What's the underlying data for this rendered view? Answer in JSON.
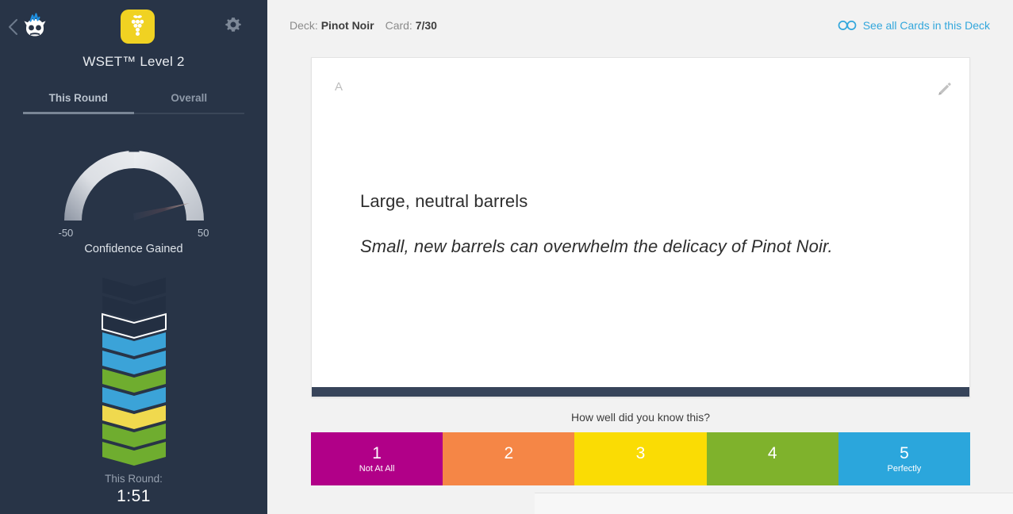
{
  "sidebar": {
    "back_icon": "back-chevron-icon",
    "brand_icon": "brainscape-owl-logo",
    "deck_icon": "grape-cluster-icon",
    "settings_icon": "gear-icon",
    "deck_title": "WSET™ Level 2",
    "tabs": [
      {
        "label": "This Round",
        "active": true
      },
      {
        "label": "Overall",
        "active": false
      }
    ],
    "gauge": {
      "min_label": "-50",
      "max_label": "50",
      "caption": "Confidence Gained",
      "min_value": -50,
      "max_value": 50,
      "needle_value": 50,
      "arc_color_start": "#8c94a2",
      "arc_color_end": "#e7e9ec"
    },
    "chevrons": {
      "colors": [
        "#232f42",
        "#232f42",
        "#232f42",
        "#3ba3d8",
        "#3ba3d8",
        "#6fad2f",
        "#3ba3d8",
        "#efd košer",
        "#6fad2f",
        "#6fad2f"
      ],
      "levels": [
        {
          "color": "#232f42",
          "outlined": false
        },
        {
          "color": "#232f42",
          "outlined": false
        },
        {
          "color": "#232f42",
          "outlined": true
        },
        {
          "color": "#3ba3d8",
          "outlined": false
        },
        {
          "color": "#3ba3d8",
          "outlined": false
        },
        {
          "color": "#6fad2f",
          "outlined": false
        },
        {
          "color": "#3ba3d8",
          "outlined": false
        },
        {
          "color": "#f0d94e",
          "outlined": false
        },
        {
          "color": "#6fad2f",
          "outlined": false
        },
        {
          "color": "#6fad2f",
          "outlined": false
        }
      ]
    },
    "round_label": "This Round:",
    "round_time": "1:51"
  },
  "header": {
    "deck_prefix": "Deck:",
    "deck_name": "Pinot Noir",
    "card_prefix": "Card:",
    "card_counter": "7/30",
    "see_all_label": "See all Cards in this Deck",
    "see_all_icon": "goggles-icon",
    "link_color": "#33a7dc"
  },
  "card": {
    "face_label": "A",
    "edit_icon": "pencil-icon",
    "line1": "Large, neutral barrels",
    "line2": "Small, new barrels can overwhelm the delicacy of Pinot Noir."
  },
  "rating": {
    "question": "How well did you know this?",
    "buttons": [
      {
        "number": "1",
        "sub": "Not At All",
        "color": "#b10088"
      },
      {
        "number": "2",
        "sub": "",
        "color": "#f58646"
      },
      {
        "number": "3",
        "sub": "",
        "color": "#fadc04"
      },
      {
        "number": "4",
        "sub": "",
        "color": "#7fb22c"
      },
      {
        "number": "5",
        "sub": "Perfectly",
        "color": "#2ba6dc"
      }
    ]
  }
}
